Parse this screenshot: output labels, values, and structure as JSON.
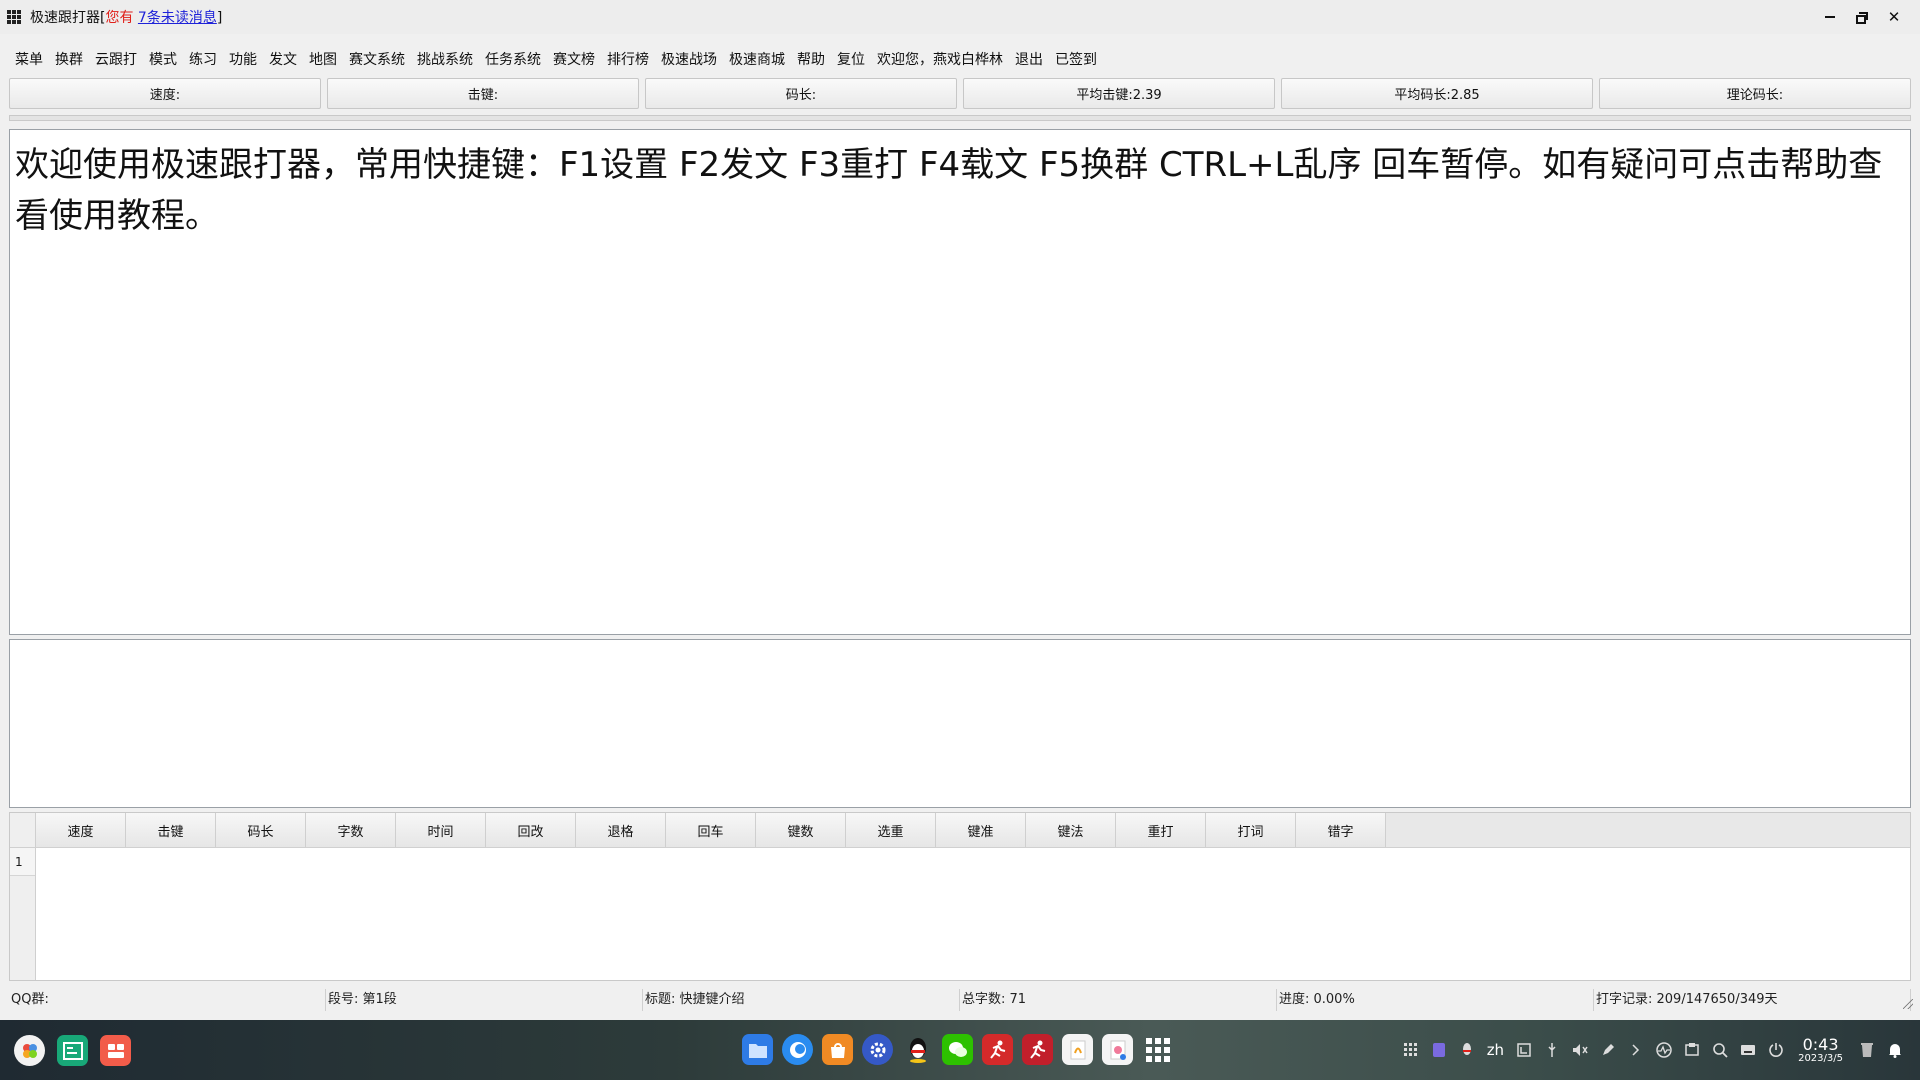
{
  "window": {
    "app_name": "极速跟打器",
    "bracket_open": "[",
    "unread_prefix": "您有",
    "unread_link": "7条未读消息",
    "bracket_close": "]",
    "controls": {
      "minimize": "minimize-icon",
      "restore": "restore-icon",
      "close": "✕"
    }
  },
  "menu": [
    "菜单",
    "换群",
    "云跟打",
    "模式",
    "练习",
    "功能",
    "发文",
    "地图",
    "赛文系统",
    "挑战系统",
    "任务系统",
    "赛文榜",
    "排行榜",
    "极速战场",
    "极速商城",
    "帮助",
    "复位",
    "欢迎您，燕戏白桦林",
    "退出",
    "已签到"
  ],
  "stats": {
    "speed": "速度:",
    "keystroke": "击键:",
    "code_len": "码长:",
    "avg_keystroke": "平均击键:2.39",
    "avg_code_len": "平均码长:2.85",
    "theory_code_len": "理论码长:"
  },
  "content": {
    "text": "欢迎使用极速跟打器，常用快捷键：F1设置 F2发文 F3重打 F4载文 F5换群 CTRL+L乱序 回车暂停。如有疑问可点击帮助查看使用教程。"
  },
  "table": {
    "columns": [
      "速度",
      "击键",
      "码长",
      "字数",
      "时间",
      "回改",
      "退格",
      "回车",
      "键数",
      "选重",
      "键准",
      "键法",
      "重打",
      "打词",
      "错字"
    ],
    "row_number": "1"
  },
  "status": {
    "qq_group": "QQ群:",
    "segment": "段号: 第1段",
    "title": "标题: 快捷键介绍",
    "total_chars": "总字数: 71",
    "progress": "进度: 0.00%",
    "record": "打字记录: 209/147650/349天"
  },
  "taskbar": {
    "lang": "zh",
    "time": "0:43",
    "date": "2023/3/5",
    "colors": {
      "accent": "#1e22d8",
      "warning": "#e0201a"
    }
  }
}
